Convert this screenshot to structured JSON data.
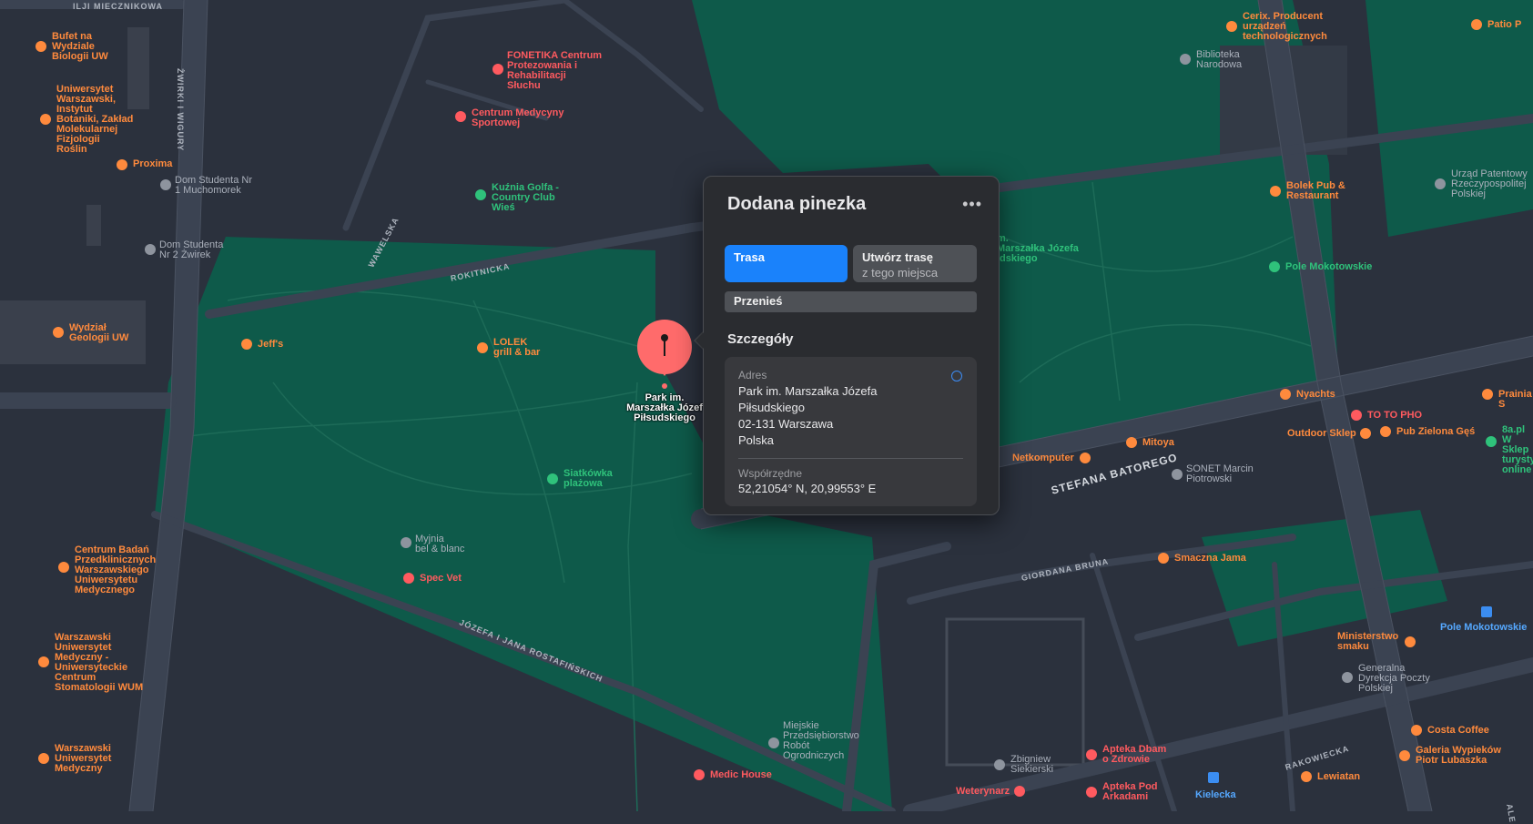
{
  "colors": {
    "background": "#2b313d",
    "park": "#0e5a4a",
    "road": "#3b4352",
    "pin": "#ff6b6b",
    "accent": "#1a82fb"
  },
  "pin": {
    "label": "Park im.\nMarszałka Józef\nPiłsudskiego",
    "icon": "pushpin-icon"
  },
  "popup": {
    "title": "Dodana pinezka",
    "more_label": "•••",
    "route_button": "Trasa",
    "create_route_title": "Utwórz trasę",
    "create_route_subtitle": "z tego miejsca",
    "move_button": "Przenieś",
    "details_heading": "Szczegóły",
    "address_label": "Adres",
    "address_lines": [
      "Park im. Marszałka Józefa",
      "Piłsudskiego",
      "02-131 Warszawa",
      "Polska"
    ],
    "coordinates_label": "Współrzędne",
    "coordinates_value": "52,21054° N, 20,99553° E"
  },
  "streets": [
    {
      "id": "s1",
      "text": "ILJI MIECZNIKOWA"
    },
    {
      "id": "s2",
      "text": "ŻWIRKI I WIGURY"
    },
    {
      "id": "s3",
      "text": "WAWELSKA"
    },
    {
      "id": "s4",
      "text": "ROKITNICKA"
    },
    {
      "id": "s5",
      "text": "STEFANA BATOREGO"
    },
    {
      "id": "s6",
      "text": "GIORDANA BRUNA"
    },
    {
      "id": "s7",
      "text": "JÓZEFA I JANA ROSTAFIŃSKICH"
    },
    {
      "id": "s8",
      "text": "RAKOWIECKA"
    },
    {
      "id": "s9",
      "text": "ALE"
    }
  ],
  "pois": [
    {
      "id": "p1",
      "text": "Bufet na\nWydziale\nBiologii UW",
      "color": "orange"
    },
    {
      "id": "p2",
      "text": "Uniwersytet\nWarszawski,\nInstytut\nBotaniki, Zakład\nMolekularnej\nFizjologii\nRoślin",
      "color": "orange"
    },
    {
      "id": "p3",
      "text": "Proxima",
      "color": "orange"
    },
    {
      "id": "p4",
      "text": "Dom Studenta Nr\n1 Muchomorek",
      "color": "gray"
    },
    {
      "id": "p5",
      "text": "Dom Studenta\nNr 2 Żwirek",
      "color": "gray"
    },
    {
      "id": "p6",
      "text": "Wydział\nGeologii UW",
      "color": "orange"
    },
    {
      "id": "p7",
      "text": "Jeff's",
      "color": "orange"
    },
    {
      "id": "p8",
      "text": "FONETIKA Centrum\nProtezowania i\nRehabilitacji\nSłuchu",
      "color": "red"
    },
    {
      "id": "p9",
      "text": "Centrum Medycyny\nSportowej",
      "color": "red"
    },
    {
      "id": "p10",
      "text": "Kuźnia Golfa -\nCountry Club\nWieś",
      "color": "green"
    },
    {
      "id": "p11",
      "text": "LOLEK\ngrill & bar",
      "color": "orange"
    },
    {
      "id": "p12",
      "text": "Siatkówka\nplażowa",
      "color": "green"
    },
    {
      "id": "p13",
      "text": "Myjnia\nbel & blanc",
      "color": "gray"
    },
    {
      "id": "p14",
      "text": "Spec Vet",
      "color": "red"
    },
    {
      "id": "p15",
      "text": "Centrum Badań\nPrzedklinicznych\nWarszawskiego\nUniwersytetu\nMedycznego",
      "color": "orange"
    },
    {
      "id": "p16",
      "text": "Warszawski\nUniwersytet\nMedyczny -\nUniwersyteckie\nCentrum\nStomatologii WUM",
      "color": "orange"
    },
    {
      "id": "p17",
      "text": "Warszawski\nUniwersytet\nMedyczny",
      "color": "orange"
    },
    {
      "id": "p18",
      "text": "Miejskie\nPrzedsiębiorstwo\nRobót\nOgrodniczych",
      "color": "gray"
    },
    {
      "id": "p19",
      "text": "Medic House",
      "color": "red"
    },
    {
      "id": "p20",
      "text": "Weterynarz",
      "color": "red"
    },
    {
      "id": "p21",
      "text": "Zbigniew\nSiekierski",
      "color": "gray"
    },
    {
      "id": "p22",
      "text": "Apteka Dbam\no Zdrowie",
      "color": "red"
    },
    {
      "id": "p23",
      "text": "Apteka Pod\nArkadami",
      "color": "red"
    },
    {
      "id": "p24",
      "text": "Kielecka",
      "color": "blue"
    },
    {
      "id": "p25",
      "text": "Lewiatan",
      "color": "orange"
    },
    {
      "id": "p26",
      "text": "Galeria Wypieków\nPiotr Lubaszka",
      "color": "orange"
    },
    {
      "id": "p27",
      "text": "Costa Coffee",
      "color": "orange"
    },
    {
      "id": "p28",
      "text": "Generalna\nDyrekcja Poczty\nPolskiej",
      "color": "gray"
    },
    {
      "id": "p29",
      "text": "Ministerstwo\nsmaku",
      "color": "orange"
    },
    {
      "id": "p30",
      "text": "Pole Mokotowskie",
      "color": "blue"
    },
    {
      "id": "p31",
      "text": "Smaczna Jama",
      "color": "orange"
    },
    {
      "id": "p32",
      "text": "Netkomputer",
      "color": "orange"
    },
    {
      "id": "p33",
      "text": "Mitoya",
      "color": "orange"
    },
    {
      "id": "p34",
      "text": "SONET Marcin\nPiotrowski",
      "color": "gray"
    },
    {
      "id": "p35",
      "text": "Nyachts",
      "color": "orange"
    },
    {
      "id": "p36",
      "text": "TO TO PHO",
      "color": "red"
    },
    {
      "id": "p37",
      "text": "Outdoor Sklep",
      "color": "orange"
    },
    {
      "id": "p38",
      "text": "Pub Zielona Gęś",
      "color": "orange"
    },
    {
      "id": "p39",
      "text": "8a.pl W\nSklep\nturysty\nonline",
      "color": "green"
    },
    {
      "id": "p40",
      "text": "Prainia S",
      "color": "orange"
    },
    {
      "id": "p41",
      "text": "Pole Mokotowskie",
      "color": "green"
    },
    {
      "id": "p42",
      "text": "Bolek Pub &\nRestaurant",
      "color": "orange"
    },
    {
      "id": "p43",
      "text": "Urząd Patentowy\nRzeczypospolitej\nPolskiej",
      "color": "gray"
    },
    {
      "id": "p44",
      "text": "Biblioteka\nNarodowa",
      "color": "gray"
    },
    {
      "id": "p45",
      "text": "Cerix. Producent\nurządzeń\ntechnologicznych",
      "color": "orange"
    },
    {
      "id": "p46",
      "text": "Patio P",
      "color": "orange"
    },
    {
      "id": "p47",
      "text": "m.\nMarszałka Józefa\nłdskiego",
      "color": "green"
    }
  ]
}
